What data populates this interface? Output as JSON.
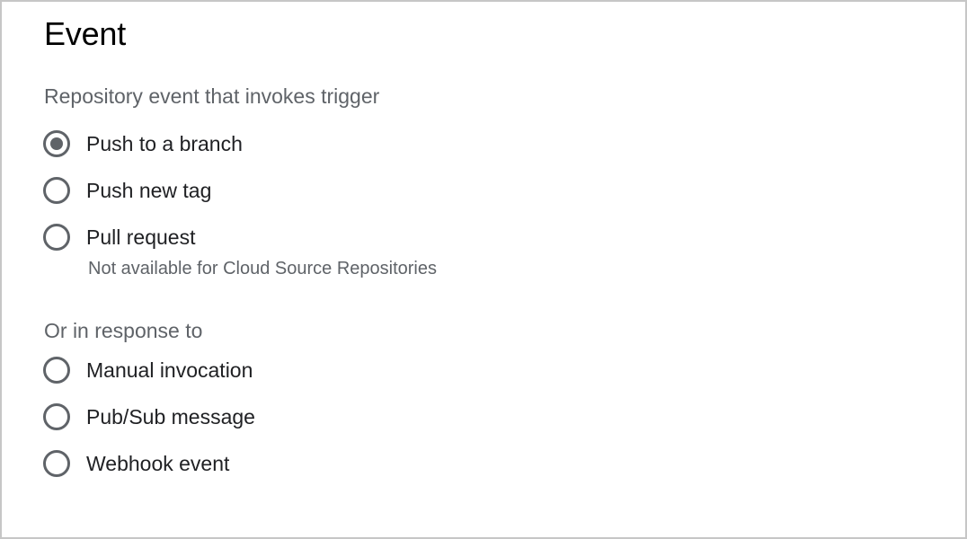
{
  "section": {
    "title": "Event"
  },
  "repository_events": {
    "label": "Repository event that invokes trigger",
    "options": [
      {
        "label": "Push to a branch",
        "selected": true
      },
      {
        "label": "Push new tag",
        "selected": false
      },
      {
        "label": "Pull request",
        "selected": false,
        "hint": "Not available for Cloud Source Repositories"
      }
    ]
  },
  "other_events": {
    "label": "Or in response to",
    "options": [
      {
        "label": "Manual invocation",
        "selected": false
      },
      {
        "label": "Pub/Sub message",
        "selected": false
      },
      {
        "label": "Webhook event",
        "selected": false
      }
    ]
  },
  "colors": {
    "border": "#c6c6c6",
    "radio": "#5f6368",
    "secondary_text": "#5f6368",
    "primary_text": "#202124"
  }
}
